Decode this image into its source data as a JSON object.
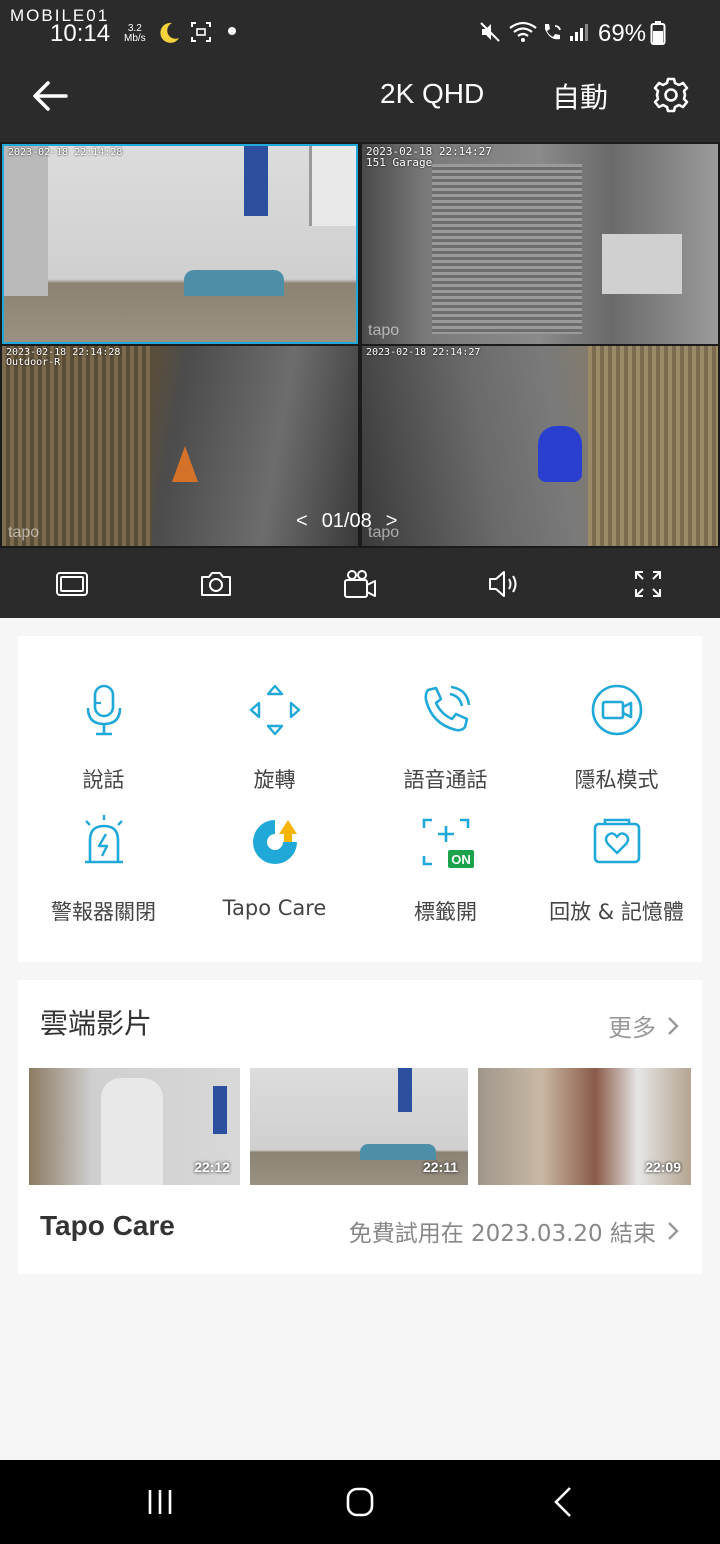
{
  "statusbar": {
    "watermark": "MOBILE01",
    "time": "10:14",
    "net_speed_value": "3.2",
    "net_speed_unit": "Mb/s",
    "battery": "69%"
  },
  "appbar": {
    "quality": "2K QHD",
    "mode": "自動"
  },
  "cameras": [
    {
      "timestamp": "2023-02-18 22:14:28",
      "tapo": ""
    },
    {
      "timestamp": "2023-02-18 22:14:27\n151 Garage",
      "tapo": "tapo"
    },
    {
      "timestamp": "2023-02-18 22:14:28\nOutdoor-R",
      "tapo": "tapo"
    },
    {
      "timestamp": "2023-02-18 22:14:27",
      "tapo": "tapo"
    }
  ],
  "pager": {
    "label": "01/08",
    "prev": "<",
    "next": ">"
  },
  "features": [
    {
      "label": "說話",
      "icon": "microphone-icon"
    },
    {
      "label": "旋轉",
      "icon": "pan-tilt-icon"
    },
    {
      "label": "語音通話",
      "icon": "phone-call-icon"
    },
    {
      "label": "隱私模式",
      "icon": "privacy-camera-icon"
    },
    {
      "label": "警報器關閉",
      "icon": "alarm-icon"
    },
    {
      "label": "Tapo Care",
      "icon": "tapo-care-icon"
    },
    {
      "label": "標籤開",
      "icon": "tag-on-icon",
      "badge": "ON"
    },
    {
      "label": "回放 & 記憶體",
      "icon": "playback-icon"
    }
  ],
  "cloud": {
    "title": "雲端影片",
    "more": "更多",
    "thumbs": [
      {
        "time": "22:12"
      },
      {
        "time": "22:11"
      },
      {
        "time": "22:09"
      }
    ],
    "care_title": "Tapo Care",
    "care_note": "免費試用在 2023.03.20 結束"
  },
  "colors": {
    "accent": "#1fa8d8",
    "dark_bg": "#2b2b2b",
    "badge_green": "#1aa34a",
    "care_yellow": "#f5b400"
  }
}
